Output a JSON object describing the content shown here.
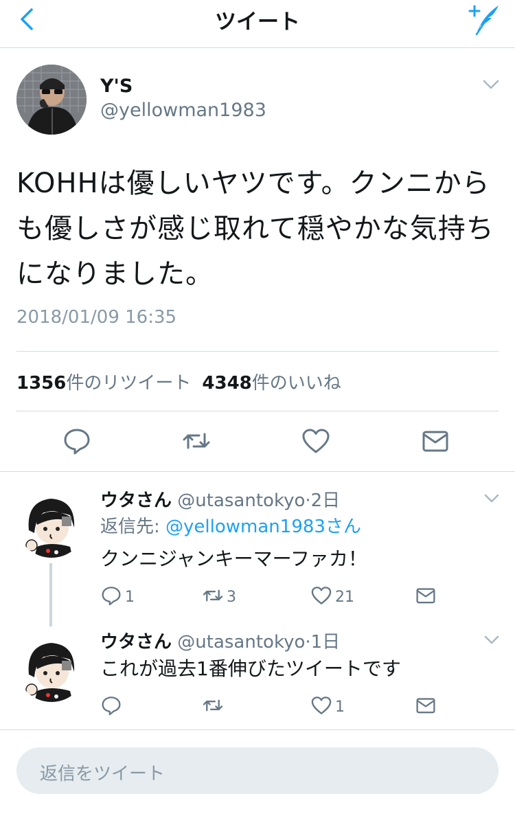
{
  "header": {
    "title": "ツイート"
  },
  "tweet": {
    "name": "Y'S",
    "handle": "@yellowman1983",
    "text": "KOHHは優しいヤツです。クンニからも優しさが感じ取れて穏やかな気持ちになりました。",
    "date": "2018/01/09 16:35",
    "retweet_count": "1356",
    "retweet_label": "件のリツイート",
    "like_count": "4348",
    "like_label": "件のいいね"
  },
  "replies": [
    {
      "name": "ウタさん",
      "handle": "@utasantokyo",
      "dot": "·",
      "time": "2日",
      "reply_prefix": "返信先: ",
      "reply_to": "@yellowman1983さん",
      "text": "クンニジャンキーマーファカ！",
      "reply_count": "1",
      "retweet_count": "3",
      "like_count": "21"
    },
    {
      "name": "ウタさん",
      "handle": "@utasantokyo",
      "dot": "·",
      "time": "1日",
      "text": "これが過去1番伸びたツイートです",
      "reply_count": "",
      "retweet_count": "",
      "like_count": "1"
    }
  ],
  "compose": {
    "placeholder": "返信をツイート"
  },
  "colors": {
    "accent": "#1da1f2",
    "text": "#14171a",
    "secondary": "#657786",
    "divider": "#d6d9dc"
  },
  "icons": [
    "back-chevron-icon",
    "compose-quill-icon",
    "chevron-down-icon",
    "reply-icon",
    "retweet-icon",
    "like-heart-icon",
    "message-envelope-icon"
  ]
}
